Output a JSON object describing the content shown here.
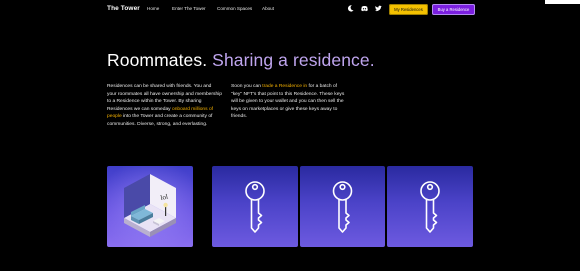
{
  "nav": {
    "brand": "The Tower",
    "links": [
      "Home",
      "Enter The Tower",
      "Common Spaces",
      "About"
    ],
    "icons": [
      "moon-icon",
      "discord-icon",
      "twitter-icon"
    ],
    "my_residences": "My Residences",
    "buy_residence": "Buy a Residence"
  },
  "hero": {
    "title": "Roommates.",
    "title_accent": "Sharing a residence."
  },
  "left_col": {
    "p1": "Residences can be shared with friends. You and your roommates all have ownership and membership to a Residence within the Tower. By sharing Residences we can someday ",
    "link": "onboard millions of people",
    "p2": " into the Tower and create a community of communities. Diverse, strong, and everlasting."
  },
  "right_col": {
    "p1": "Soon you can ",
    "link": "trade a Residence in",
    "p2": " for a batch of \"key\" NFT's that point to this Residence. These keys will be given to your wallet and you can then sell the keys on marketplaces or give these keys away to friends."
  },
  "cards": [
    {
      "name": "residence-room-image",
      "kind": "room"
    },
    {
      "name": "key-card-1",
      "kind": "key"
    },
    {
      "name": "key-card-2",
      "kind": "key"
    },
    {
      "name": "key-card-3",
      "kind": "key"
    }
  ],
  "colors": {
    "accent_purple": "#bfa5ee",
    "highlight_gold": "#f4b100",
    "button_yellow": "#f4c100",
    "button_purple": "#7b1fe0"
  }
}
